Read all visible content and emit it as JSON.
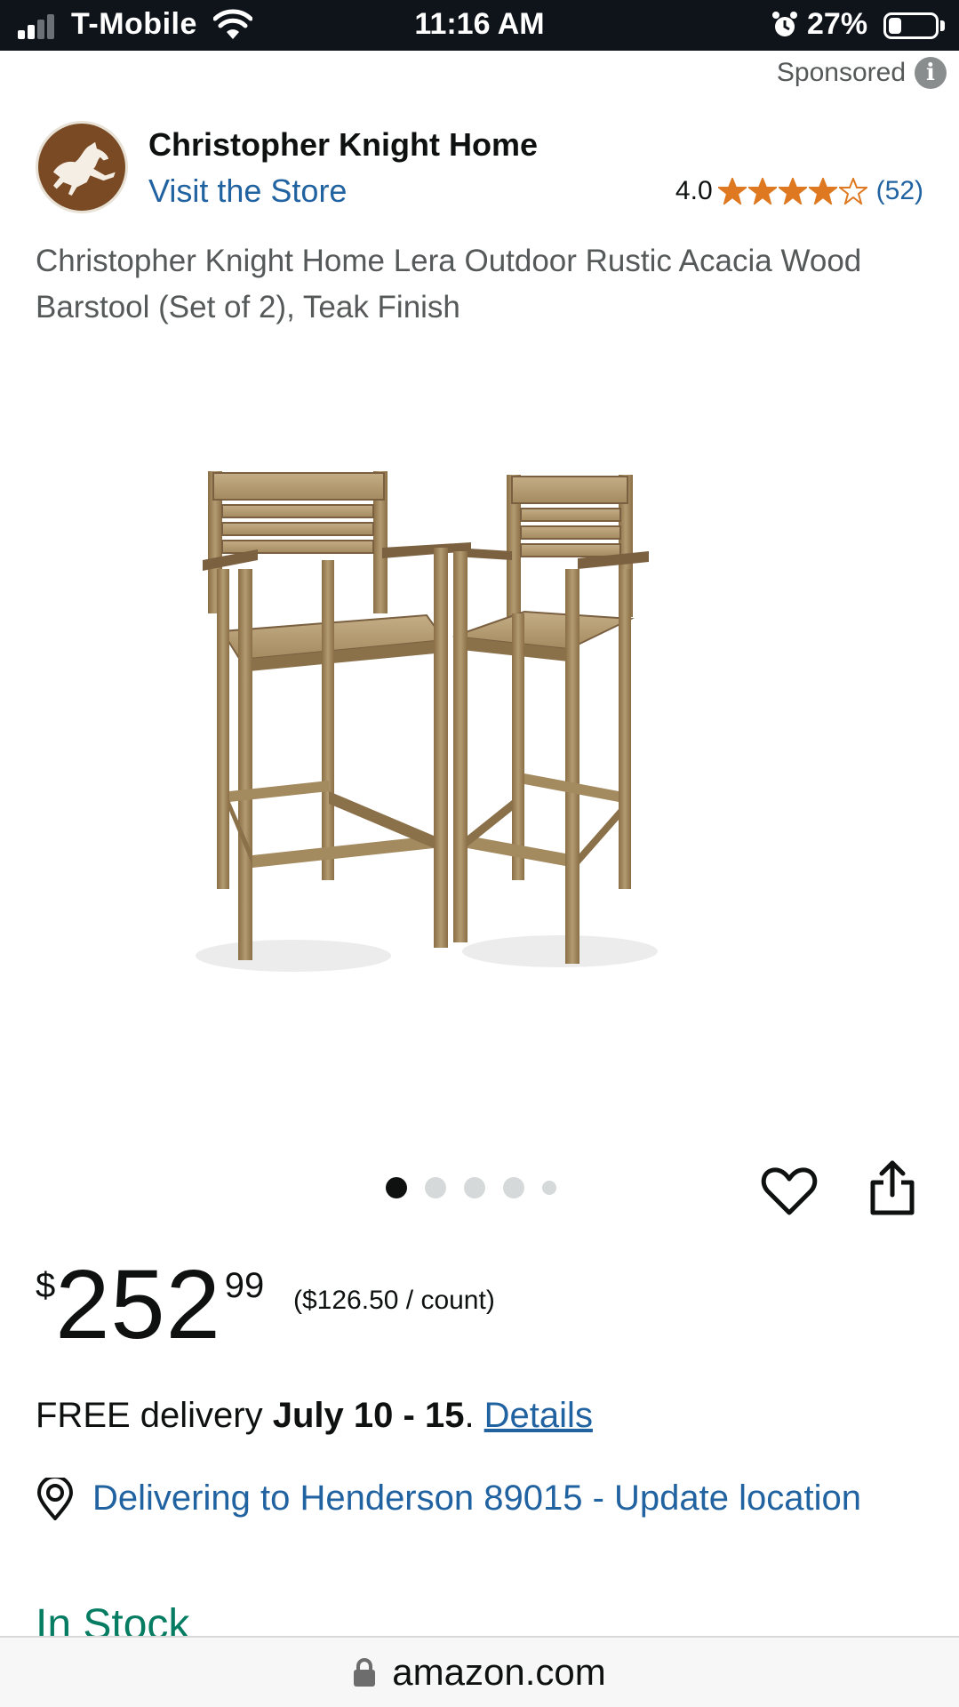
{
  "status_bar": {
    "carrier": "T-Mobile",
    "time": "11:16 AM",
    "battery": "27%",
    "battery_level": 0.27,
    "signal_bars": 2
  },
  "sponsored": {
    "label": "Sponsored",
    "icon": "info-icon"
  },
  "brand": {
    "name": "Christopher Knight Home",
    "visit_store": "Visit the Store",
    "logo_icon": "horse-logo-icon",
    "logo_color": "#7a4a25"
  },
  "rating": {
    "value": "4.0",
    "stars": 4.0,
    "max_stars": 5,
    "count": "(52)",
    "star_color": "#de7921"
  },
  "product": {
    "title": "Christopher Knight Home Lera Outdoor Rustic Acacia Wood Barstool (Set of 2), Teak Finish",
    "image_icon": "barstool-pair-image"
  },
  "carousel": {
    "total_dots": 5,
    "active_index": 0
  },
  "actions": {
    "wishlist_icon": "heart-icon",
    "share_icon": "share-icon"
  },
  "price": {
    "symbol": "$",
    "whole": "252",
    "fraction": "99",
    "unit_price": "($126.50 / count)"
  },
  "delivery": {
    "prefix": "FREE delivery ",
    "date": "July 10 - 15",
    "suffix": ". ",
    "details_link": "Details"
  },
  "location": {
    "icon": "location-pin-icon",
    "text": "Delivering to Henderson 89015 - Update location"
  },
  "stock": {
    "text": "In Stock",
    "color": "#067d62"
  },
  "url_bar": {
    "domain": "amazon.com",
    "icon": "lock-icon"
  },
  "colors": {
    "link": "#2162a1",
    "status_bar": "#0f141b"
  }
}
